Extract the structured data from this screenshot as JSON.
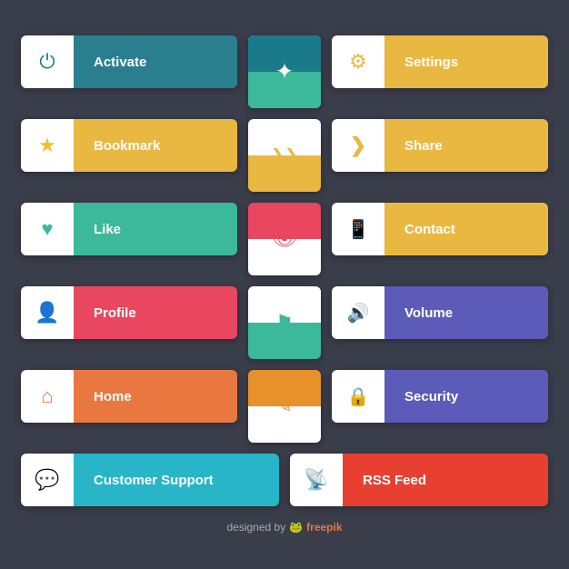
{
  "buttons": {
    "activate": {
      "label": "Activate",
      "icon": "⏻",
      "color": "#1a7a8a",
      "iconColor": "#1a7a8a"
    },
    "settings": {
      "label": "Settings",
      "icon": "⚙",
      "color": "#e8b840",
      "iconColor": "#e8b840"
    },
    "bookmark": {
      "label": "Bookmark",
      "icon": "★",
      "color": "#e8b840",
      "iconColor": "#f0c030"
    },
    "share": {
      "label": "Share",
      "icon": "❯",
      "color": "#e8b840",
      "iconColor": "#e8b840"
    },
    "like": {
      "label": "Like",
      "icon": "♥",
      "color": "#3cb89a",
      "iconColor": "#3cb89a"
    },
    "contact": {
      "label": "Contact",
      "icon": "📱",
      "color": "#e8b840",
      "iconColor": "#e8b840"
    },
    "profile": {
      "label": "Profile",
      "icon": "👤",
      "color": "#e8475f",
      "iconColor": "#e8475f"
    },
    "volume": {
      "label": "Volume",
      "icon": "🔊",
      "color": "#5c5bba",
      "iconColor": "#5c5bba"
    },
    "home": {
      "label": "Home",
      "icon": "⌂",
      "color": "#e87840",
      "iconColor": "#e87840"
    },
    "security": {
      "label": "Security",
      "icon": "🔒",
      "color": "#5c5bba",
      "iconColor": "#5c5bba"
    },
    "customer_support": {
      "label": "Customer Support",
      "icon": "💬",
      "color": "#28b5c8",
      "iconColor": "#28b5c8"
    },
    "rss_feed": {
      "label": "RSS Feed",
      "icon": "📡",
      "color": "#e84030",
      "iconColor": "#e84030"
    }
  },
  "center_cards": {
    "c1": {
      "top": "#2a5fa5",
      "bottom": "#3cb89a",
      "icon": "✦"
    },
    "c2": {
      "top": "#e8b840",
      "bottom": "#e8b840",
      "icon": "❯❯"
    },
    "c3": {
      "top": "#e8475f",
      "bottom": "#e8475f",
      "icon": "👁"
    },
    "c4": {
      "top": "#3cb89a",
      "bottom": "#3cb89a",
      "icon": "⚑"
    },
    "c5": {
      "top": "#e8902a",
      "bottom": "#e8902a",
      "icon": "✎"
    }
  },
  "footer": {
    "text": "designed by",
    "brand": "freepik"
  }
}
